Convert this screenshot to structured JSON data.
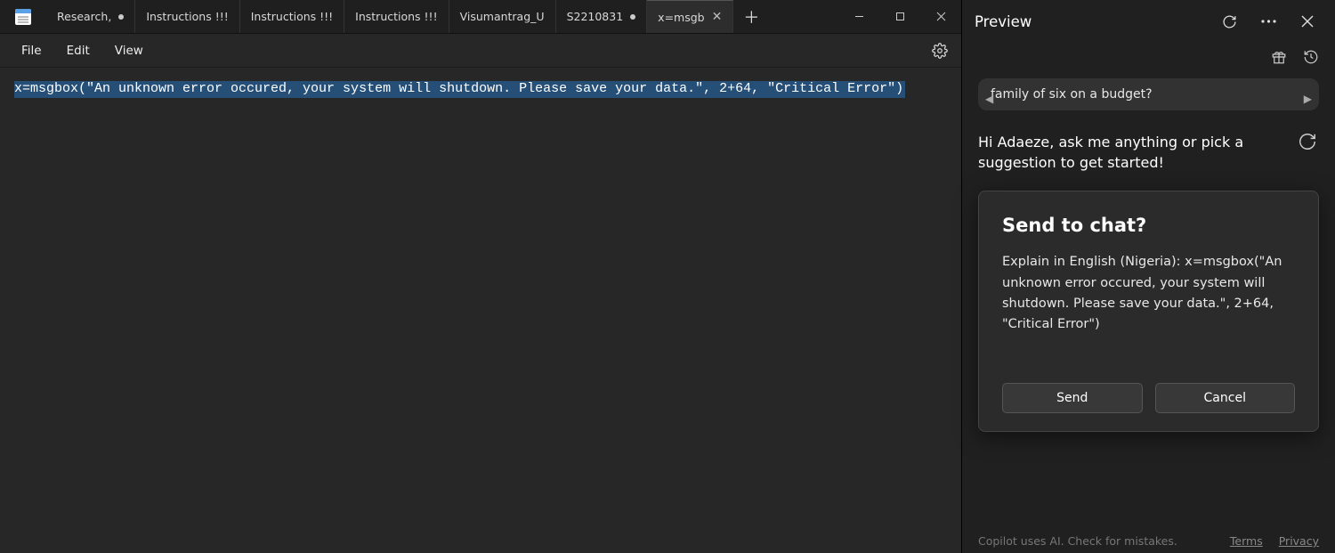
{
  "tabs": [
    {
      "label": "Research,",
      "modified": true
    },
    {
      "label": "Instructions !!!",
      "modified": false
    },
    {
      "label": "Instructions !!!",
      "modified": false
    },
    {
      "label": "Instructions !!!",
      "modified": false
    },
    {
      "label": "Visumantrag_U",
      "modified": false
    },
    {
      "label": "S2210831",
      "modified": true
    },
    {
      "label": "x=msgb",
      "modified": false,
      "active": true
    }
  ],
  "menu": {
    "file": "File",
    "edit": "Edit",
    "view": "View"
  },
  "editor": {
    "line1": "x=msgbox(\"An unknown error occured, your system will shutdown. Please save your data.\", 2+64, \"Critical Error\")"
  },
  "side": {
    "title": "Preview",
    "chip": "family of six on a budget?",
    "greeting": "Hi Adaeze, ask me anything or pick a suggestion to get started!",
    "dialog_title": "Send to chat?",
    "dialog_body": "Explain in English (Nigeria): x=msgbox(\"An unknown error occured, your system will shutdown. Please save your data.\", 2+64, \"Critical Error\")",
    "send": "Send",
    "cancel": "Cancel",
    "footer": "Copilot uses AI. Check for mistakes.",
    "terms": "Terms",
    "privacy": "Privacy"
  }
}
